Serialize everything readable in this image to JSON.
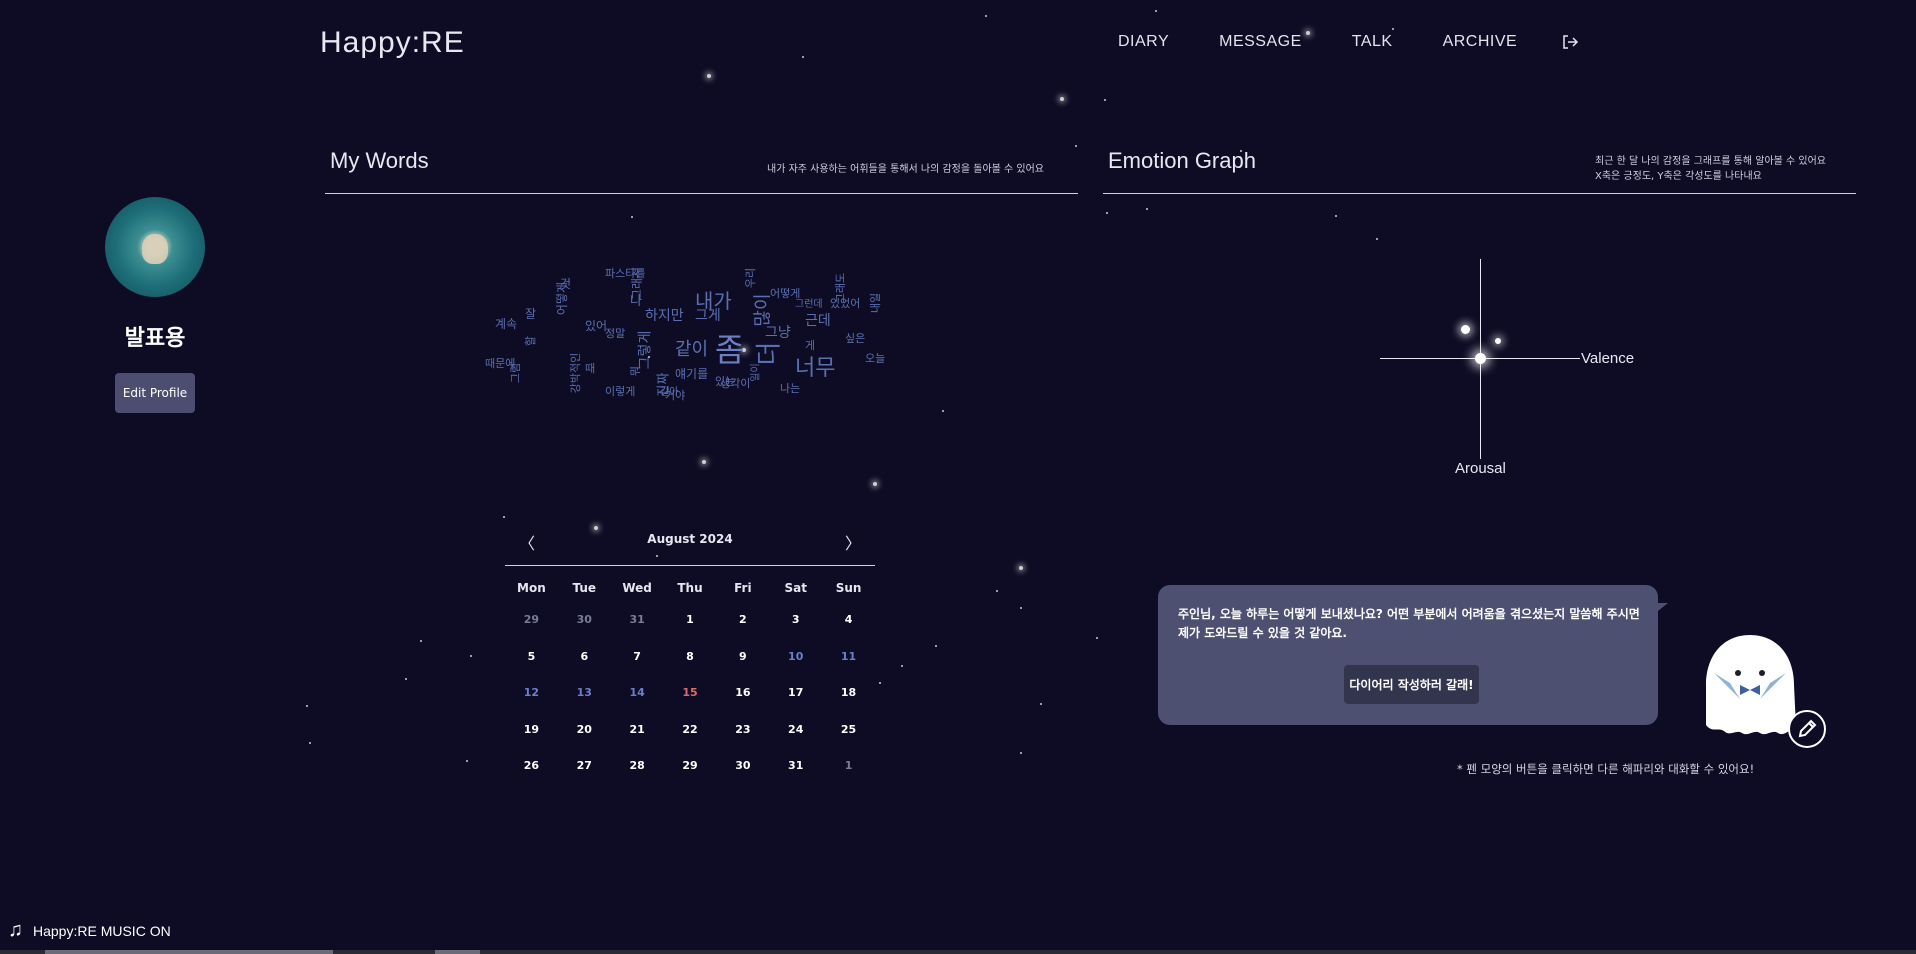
{
  "header": {
    "logo": "Happy:RE",
    "nav": [
      "DIARY",
      "MESSAGE",
      "TALK",
      "ARCHIVE"
    ],
    "logout_icon": "logout-icon"
  },
  "profile": {
    "name": "발표용",
    "edit_label": "Edit Profile"
  },
  "my_words": {
    "title": "My Words",
    "description": "내가 자주 사용하는 어휘들을 통해서 나의 감정을 돌아볼 수 있어요",
    "words": [
      "좀",
      "더",
      "너무",
      "많이",
      "내가",
      "같이",
      "그렇게",
      "그게",
      "하지만",
      "나",
      "뭐",
      "진짜",
      "근데",
      "그냥",
      "있는",
      "얘기를",
      "그래서",
      "어떻게",
      "것",
      "잘",
      "이렇게",
      "강박적인",
      "정말",
      "게",
      "내일",
      "오늘",
      "그래도",
      "파스타를",
      "계속",
      "때문에",
      "있어",
      "우리",
      "거야",
      "나는",
      "있었어",
      "생각이",
      "할",
      "어떻게",
      "그럼",
      "싶은",
      "때",
      "일이",
      "그런데",
      "같아"
    ]
  },
  "emotion_graph": {
    "title": "Emotion Graph",
    "description_line1": "최근 한 달 나의 감정을 그래프를 통해 알아볼 수 있어요",
    "description_line2": "X축은 긍정도, Y축은 각성도를 나타내요",
    "x_label": "Valence",
    "y_label": "Arousal"
  },
  "calendar": {
    "month_label": "August 2024",
    "prev": "〈",
    "next": "〉",
    "weekdays": [
      "Mon",
      "Tue",
      "Wed",
      "Thu",
      "Fri",
      "Sat",
      "Sun"
    ],
    "days": [
      {
        "d": "29",
        "t": "muted"
      },
      {
        "d": "30",
        "t": "muted"
      },
      {
        "d": "31",
        "t": "muted"
      },
      {
        "d": "1",
        "t": ""
      },
      {
        "d": "2",
        "t": ""
      },
      {
        "d": "3",
        "t": ""
      },
      {
        "d": "4",
        "t": ""
      },
      {
        "d": "5",
        "t": ""
      },
      {
        "d": "6",
        "t": ""
      },
      {
        "d": "7",
        "t": ""
      },
      {
        "d": "8",
        "t": ""
      },
      {
        "d": "9",
        "t": ""
      },
      {
        "d": "10",
        "t": "blue"
      },
      {
        "d": "11",
        "t": "blue"
      },
      {
        "d": "12",
        "t": "blue"
      },
      {
        "d": "13",
        "t": "blue"
      },
      {
        "d": "14",
        "t": "blue"
      },
      {
        "d": "15",
        "t": "red"
      },
      {
        "d": "16",
        "t": ""
      },
      {
        "d": "17",
        "t": ""
      },
      {
        "d": "18",
        "t": ""
      },
      {
        "d": "19",
        "t": ""
      },
      {
        "d": "20",
        "t": ""
      },
      {
        "d": "21",
        "t": ""
      },
      {
        "d": "22",
        "t": ""
      },
      {
        "d": "23",
        "t": ""
      },
      {
        "d": "24",
        "t": ""
      },
      {
        "d": "25",
        "t": ""
      },
      {
        "d": "26",
        "t": ""
      },
      {
        "d": "27",
        "t": ""
      },
      {
        "d": "28",
        "t": ""
      },
      {
        "d": "29",
        "t": ""
      },
      {
        "d": "30",
        "t": ""
      },
      {
        "d": "31",
        "t": ""
      },
      {
        "d": "1",
        "t": "muted"
      }
    ]
  },
  "chat": {
    "message": "주인님, 오늘 하루는 어떻게 보내셨나요? 어떤 부분에서 어려움을 겪으셨는지 말씀해 주시면 제가 도와드릴 수 있을 것 같아요.",
    "write_button": "다이어리 작성하러 갈래!",
    "hint": "* 펜 모양의 버튼을 클릭하면 다른 해파리와 대화할 수 있어요!"
  },
  "music": {
    "label": "Happy:RE MUSIC ON",
    "icon": "music-note-icon"
  },
  "colors": {
    "background": "#0e0c24",
    "panel": "#4e5072",
    "word": "#5b6fb0",
    "holiday": "#e46a6a"
  }
}
